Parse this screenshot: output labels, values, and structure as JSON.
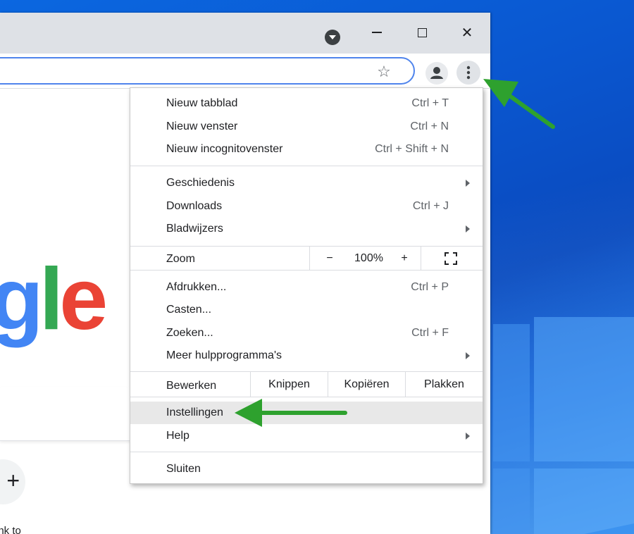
{
  "menu": {
    "items1": [
      {
        "label": "Nieuw tabblad",
        "shortcut": "Ctrl + T"
      },
      {
        "label": "Nieuw venster",
        "shortcut": "Ctrl + N"
      },
      {
        "label": "Nieuw incognitovenster",
        "shortcut": "Ctrl + Shift + N"
      }
    ],
    "items2": [
      {
        "label": "Geschiedenis",
        "shortcut": ""
      },
      {
        "label": "Downloads",
        "shortcut": "Ctrl + J"
      },
      {
        "label": "Bladwijzers",
        "shortcut": ""
      }
    ],
    "zoom": {
      "label": "Zoom",
      "minus": "−",
      "value": "100%",
      "plus": "+"
    },
    "items3": [
      {
        "label": "Afdrukken...",
        "shortcut": "Ctrl + P"
      },
      {
        "label": "Casten...",
        "shortcut": ""
      },
      {
        "label": "Zoeken...",
        "shortcut": "Ctrl + F"
      },
      {
        "label": "Meer hulpprogramma's",
        "shortcut": ""
      }
    ],
    "edit": {
      "label": "Bewerken",
      "cut": "Knippen",
      "copy": "Kopiëren",
      "paste": "Plakken"
    },
    "items4": [
      {
        "label": "Instellingen"
      },
      {
        "label": "Help"
      }
    ],
    "exit": {
      "label": "Sluiten"
    }
  },
  "page": {
    "logo_fragment": {
      "g": "g",
      "l": "l",
      "e": "e"
    },
    "add_shortcut_symbol": "+",
    "shortcut_label": "ink to"
  },
  "window": {
    "minimize_symbol": "—",
    "close_symbol": "✕",
    "star_symbol": "☆"
  },
  "colors": {
    "annotation_arrow": "#2ea12e",
    "omnibox_border": "#4f84ec",
    "highlight": "#e8e8e8"
  },
  "icons": [
    "tab-search-icon",
    "star-icon",
    "profile-icon",
    "kebab-menu-icon",
    "fullscreen-icon",
    "submenu-arrow-icon"
  ]
}
